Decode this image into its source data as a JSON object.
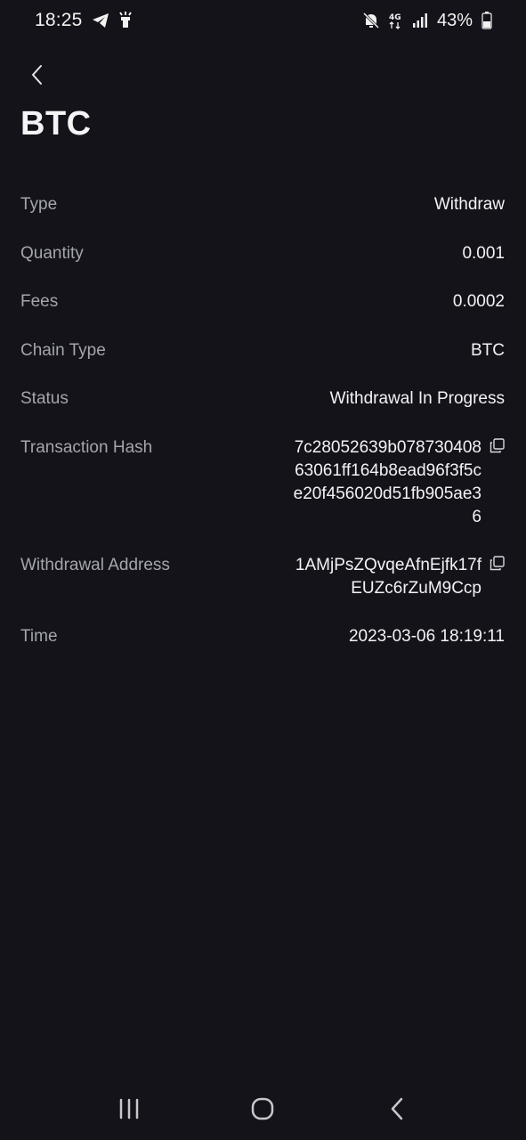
{
  "status_bar": {
    "time": "18:25",
    "battery": "43%",
    "network": "4G",
    "icons": [
      "telegram-icon",
      "flashlight-icon",
      "mute-icon",
      "network-4g-icon",
      "signal-icon",
      "battery-icon"
    ]
  },
  "header": {
    "back_icon": "chevron-left-icon",
    "title": "BTC"
  },
  "details": [
    {
      "label": "Type",
      "value": "Withdraw"
    },
    {
      "label": "Quantity",
      "value": "0.001"
    },
    {
      "label": "Fees",
      "value": "0.0002"
    },
    {
      "label": "Chain Type",
      "value": "BTC"
    },
    {
      "label": "Status",
      "value": "Withdrawal In Progress"
    },
    {
      "label": "Transaction Hash",
      "value": "7c28052639b07873040863061ff164b8ead96f3f5ce20f456020d51fb905ae36",
      "copy_icon": "copy-icon"
    },
    {
      "label": "Withdrawal Address",
      "value": "1AMjPsZQvqeAfnEjfk17fEUZc6rZuM9Ccp",
      "copy_icon": "copy-icon"
    },
    {
      "label": "Time",
      "value": "2023-03-06 18:19:11"
    }
  ],
  "nav_bar": {
    "icons": [
      "recent-apps-icon",
      "home-icon",
      "back-icon"
    ]
  },
  "colors": {
    "background": "#131319",
    "label": "#a4a5ad",
    "value": "#f3f3f5"
  }
}
